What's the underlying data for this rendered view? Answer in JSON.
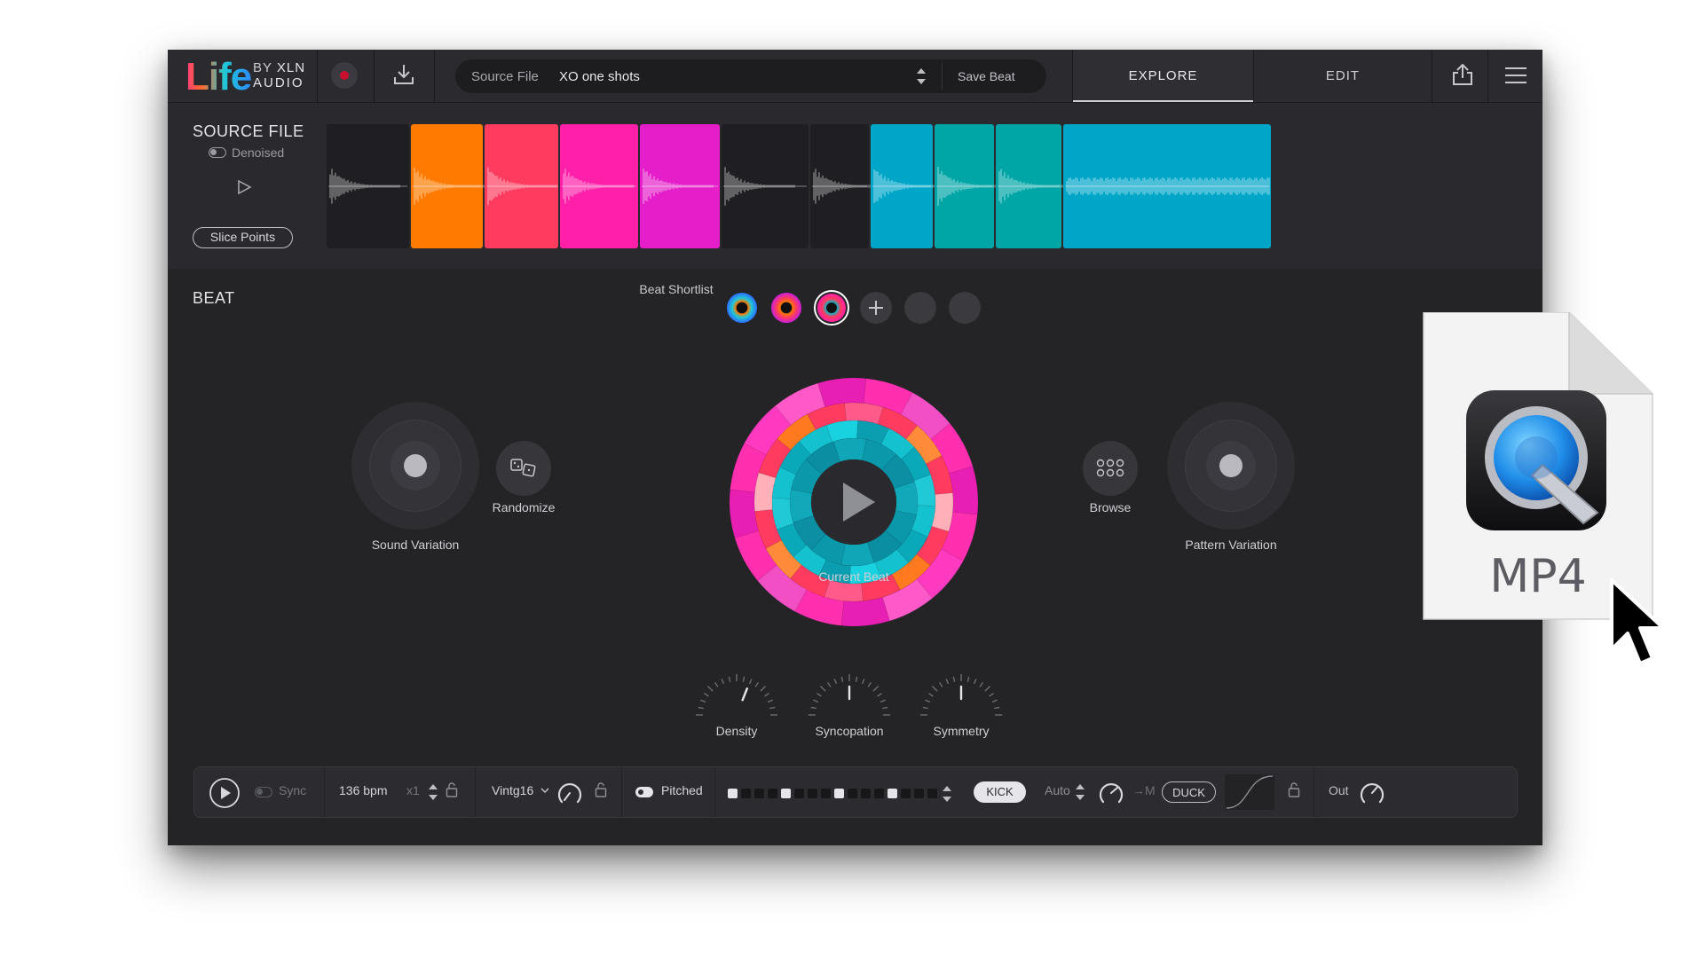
{
  "app": {
    "logo_name": "Life",
    "logo_by": "BY",
    "logo_brand": "XLN",
    "logo_sub": "AUDIO"
  },
  "topbar": {
    "source_label": "Source File",
    "source_value": "XO one shots",
    "save_beat_label": "Save Beat",
    "tabs": [
      {
        "label": "EXPLORE",
        "active": true
      },
      {
        "label": "EDIT",
        "active": false
      }
    ],
    "icons": [
      "record-icon",
      "download-icon",
      "share-icon",
      "menu-icon"
    ]
  },
  "source_panel": {
    "title": "SOURCE FILE",
    "denoised_label": "Denoised",
    "slice_points_label": "Slice Points",
    "slices": [
      {
        "color": "#1f1f23"
      },
      {
        "color": "#ff7a00"
      },
      {
        "color": "#ff3b5f"
      },
      {
        "color": "#ff1fa8"
      },
      {
        "color": "#e41fc9"
      },
      {
        "color": "#1f1f23"
      },
      {
        "color": "#1f1f23"
      },
      {
        "color": "#00a6c8"
      },
      {
        "color": "#00a6a6"
      },
      {
        "color": "#00a6a6"
      },
      {
        "color": "#00a6c8"
      }
    ]
  },
  "beat": {
    "title": "BEAT",
    "shortlist_label": "Beat Shortlist",
    "sound_variation_label": "Sound Variation",
    "randomize_label": "Randomize",
    "current_beat_label": "Current Beat",
    "browse_label": "Browse",
    "pattern_variation_label": "Pattern Variation",
    "dials": [
      {
        "label": "Density",
        "value": 0.62
      },
      {
        "label": "Syncopation",
        "value": 0.5
      },
      {
        "label": "Symmetry",
        "value": 0.5
      }
    ]
  },
  "bottombar": {
    "sync_label": "Sync",
    "bpm_label": "136 bpm",
    "multiplier_label": "x1",
    "swing_label": "Vintg16",
    "pitched_label": "Pitched",
    "kick_label": "KICK",
    "auto_label": "Auto",
    "arrow_m_label": "→M",
    "duck_label": "DUCK",
    "out_label": "Out",
    "steps": [
      1,
      0,
      0,
      0,
      1,
      0,
      0,
      0,
      1,
      0,
      0,
      0,
      1,
      0,
      0,
      0
    ]
  },
  "file_icon": {
    "extension_label": "MP4",
    "icon": "quicktime-icon"
  }
}
